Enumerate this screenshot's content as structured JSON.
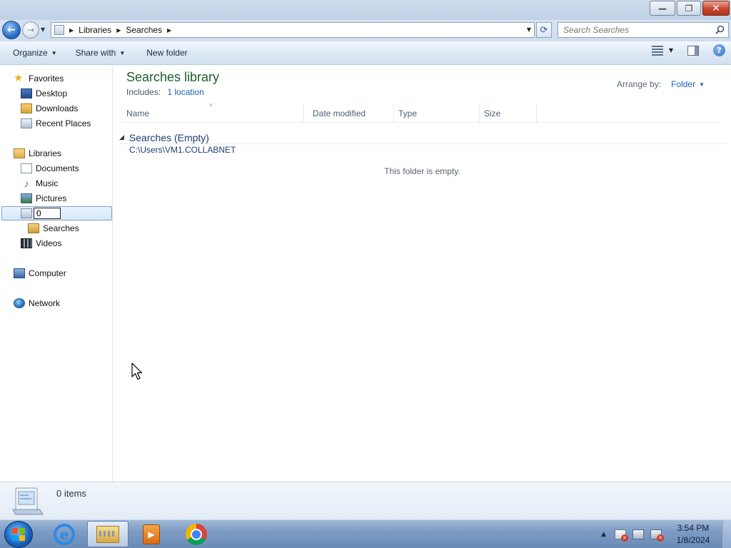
{
  "window": {
    "caption_buttons": {
      "minimize": "—",
      "restore": "❐",
      "close": "✕"
    }
  },
  "address_bar": {
    "breadcrumbs": [
      "Libraries",
      "Searches"
    ],
    "search_placeholder": "Search Searches"
  },
  "toolbar": {
    "organize": "Organize",
    "share_with": "Share with",
    "new_folder": "New folder"
  },
  "nav": {
    "favorites": {
      "label": "Favorites",
      "items": [
        {
          "label": "Desktop",
          "icon": "desktop-icon"
        },
        {
          "label": "Downloads",
          "icon": "downloads-icon"
        },
        {
          "label": "Recent Places",
          "icon": "recent-places-icon"
        }
      ]
    },
    "libraries": {
      "label": "Libraries",
      "items": [
        {
          "label": "Documents",
          "icon": "documents-icon"
        },
        {
          "label": "Music",
          "icon": "music-icon"
        },
        {
          "label": "Pictures",
          "icon": "pictures-icon"
        }
      ],
      "rename_value": "0",
      "subfolder": "Searches",
      "after": [
        {
          "label": "Videos",
          "icon": "videos-icon"
        }
      ]
    },
    "computer": "Computer",
    "network": "Network"
  },
  "content": {
    "title": "Searches library",
    "includes_label": "Includes:",
    "includes_link": "1 location",
    "arrange_label": "Arrange by:",
    "arrange_value": "Folder",
    "columns": [
      "Name",
      "Date modified",
      "Type",
      "Size"
    ],
    "group_title": "Searches (Empty)",
    "group_path": "C:\\Users\\VM1.COLLABNET",
    "empty_message": "This folder is empty."
  },
  "details": {
    "item_count": "0 items"
  },
  "taskbar": {
    "apps": [
      "internet-explorer-icon",
      "windows-explorer-icon",
      "windows-media-player-icon",
      "chrome-icon"
    ],
    "active_app": "windows-explorer-icon",
    "clock_time": "3:54 PM",
    "clock_date": "1/8/2024"
  }
}
